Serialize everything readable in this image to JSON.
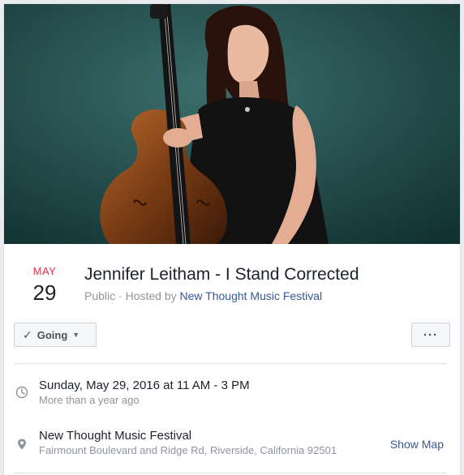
{
  "event": {
    "cover_alt": "Event cover photo",
    "month": "MAY",
    "day": "29",
    "title": "Jennifer Leitham - I Stand Corrected",
    "visibility": "Public",
    "hosted_by_prefix": "Hosted by",
    "host": "New Thought Music Festival"
  },
  "actions": {
    "going_label": "Going",
    "more_label": "···"
  },
  "details": {
    "time_main": "Sunday, May 29, 2016 at 11 AM - 3 PM",
    "time_sub": "More than a year ago",
    "place_name": "New Thought Music Festival",
    "place_address": "Fairmount Boulevard and Ridge Rd, Riverside, California 92501",
    "show_map_label": "Show Map"
  },
  "icons": {
    "check": "check-icon",
    "caret": "caret-down-icon",
    "clock": "clock-icon",
    "pin": "map-pin-icon"
  },
  "colors": {
    "month": "#f02849",
    "link": "#365899",
    "muted": "#90949c",
    "text": "#1d2129"
  }
}
